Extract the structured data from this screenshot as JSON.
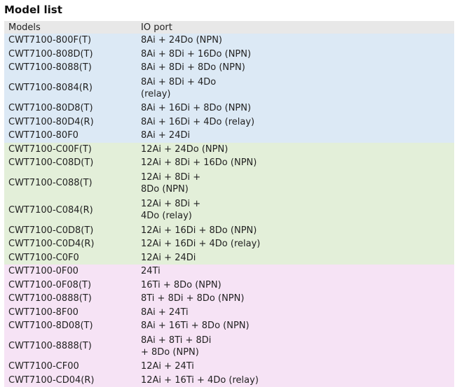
{
  "title": "Model list",
  "columns": [
    "Models",
    "IO port"
  ],
  "colors": {
    "header": "#e8e8e8",
    "blue": "#dce9f5",
    "green": "#e3efd9",
    "pink": "#f6e3f5"
  },
  "rows": [
    {
      "model": "CWT7100-800F(T)",
      "io": "8Ai + 24Do (NPN)",
      "group": "blue"
    },
    {
      "model": "CWT7100-808D(T)",
      "io": "8Ai + 8Di + 16Do (NPN)",
      "group": "blue"
    },
    {
      "model": "CWT7100-8088(T)",
      "io": "8Ai + 8Di + 8Do (NPN)",
      "group": "blue"
    },
    {
      "model": "CWT7100-8084(R)",
      "io": "8Ai + 8Di + 4Do (relay)",
      "group": "blue",
      "tall": true
    },
    {
      "model": "CWT7100-80D8(T)",
      "io": "8Ai + 16Di + 8Do (NPN)",
      "group": "blue"
    },
    {
      "model": "CWT7100-80D4(R)",
      "io": "8Ai + 16Di + 4Do (relay)",
      "group": "blue"
    },
    {
      "model": "CWT7100-80F0",
      "io": "8Ai + 24Di",
      "group": "blue"
    },
    {
      "model": "CWT7100-C00F(T)",
      "io": "12Ai + 24Do (NPN)",
      "group": "green"
    },
    {
      "model": "CWT7100-C08D(T)",
      "io": "12Ai + 8Di + 16Do (NPN)",
      "group": "green"
    },
    {
      "model": "CWT7100-C088(T)",
      "io": "12Ai + 8Di + 8Do (NPN)",
      "group": "green",
      "tall": true
    },
    {
      "model": "CWT7100-C084(R)",
      "io": "12Ai + 8Di + 4Do (relay)",
      "group": "green",
      "tall": true
    },
    {
      "model": "CWT7100-C0D8(T)",
      "io": "12Ai + 16Di + 8Do (NPN)",
      "group": "green"
    },
    {
      "model": "CWT7100-C0D4(R)",
      "io": "12Ai + 16Di + 4Do (relay)",
      "group": "green"
    },
    {
      "model": "CWT7100-C0F0",
      "io": "12Ai + 24Di",
      "group": "green"
    },
    {
      "model": "CWT7100-0F00",
      "io": "24Ti",
      "group": "pink"
    },
    {
      "model": "CWT7100-0F08(T)",
      "io": "16Ti + 8Do (NPN)",
      "group": "pink"
    },
    {
      "model": "CWT7100-0888(T)",
      "io": "8Ti + 8Di + 8Do (NPN)",
      "group": "pink"
    },
    {
      "model": "CWT7100-8F00",
      "io": "8Ai + 24Ti",
      "group": "pink"
    },
    {
      "model": "CWT7100-8D08(T)",
      "io": "8Ai + 16Ti + 8Do (NPN)",
      "group": "pink"
    },
    {
      "model": "CWT7100-8888(T)",
      "io": "8Ai + 8Ti + 8Di + 8Do (NPN)",
      "group": "pink",
      "tall": true
    },
    {
      "model": "CWT7100-CF00",
      "io": "12Ai + 24Ti",
      "group": "pink"
    },
    {
      "model": "CWT7100-CD04(R)",
      "io": "12Ai + 16Ti + 4Do (relay)",
      "group": "pink"
    }
  ]
}
